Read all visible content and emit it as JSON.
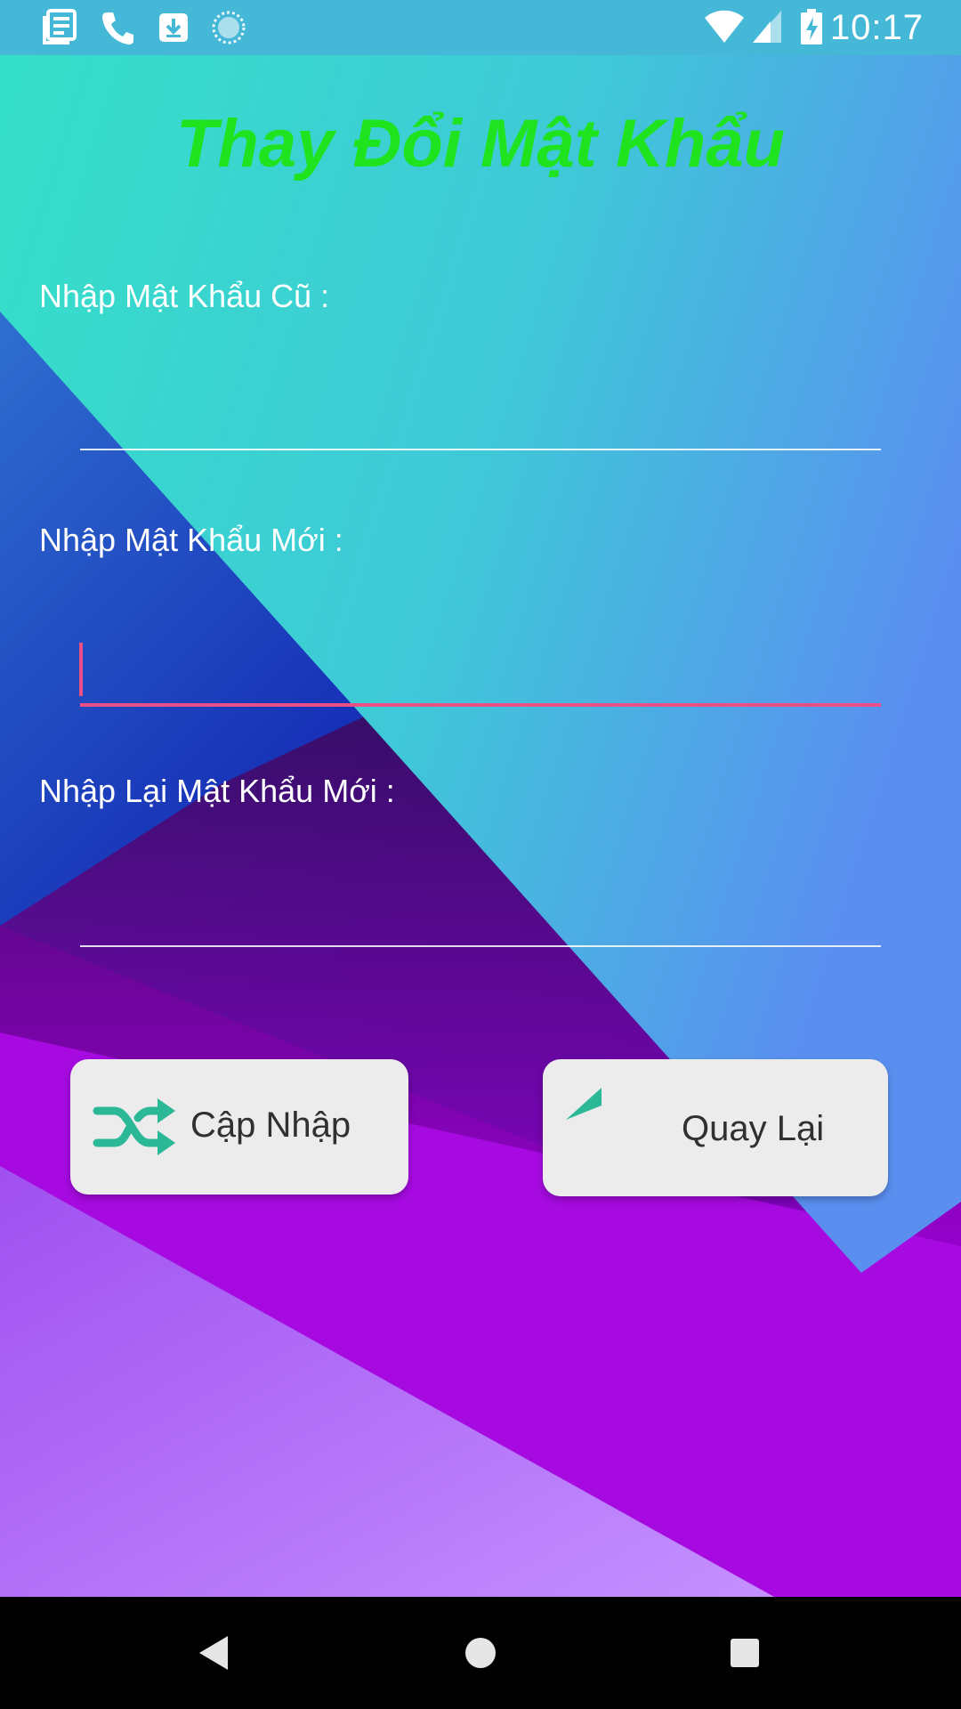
{
  "status_bar": {
    "time": "10:17",
    "icons_left": [
      "news-icon",
      "phone-icon",
      "download-icon",
      "sync-icon"
    ],
    "icons_right": [
      "wifi-icon",
      "signal-icon",
      "battery-charging-icon"
    ]
  },
  "screen": {
    "title": "Thay Đổi Mật Khẩu",
    "title_color": "#1fe31f"
  },
  "form": {
    "old_password_label": "Nhập Mật Khẩu Cũ :",
    "new_password_label": "Nhập Mật Khẩu Mới :",
    "confirm_password_label": "Nhập Lại Mật Khẩu Mới :",
    "focus_color": "#ea4f86"
  },
  "buttons": {
    "update_label": "Cập Nhập",
    "back_label": "Quay Lại",
    "icon_color": "#2ab897"
  },
  "nav_bar": {
    "items": [
      "back-icon",
      "home-icon",
      "recents-icon"
    ]
  }
}
